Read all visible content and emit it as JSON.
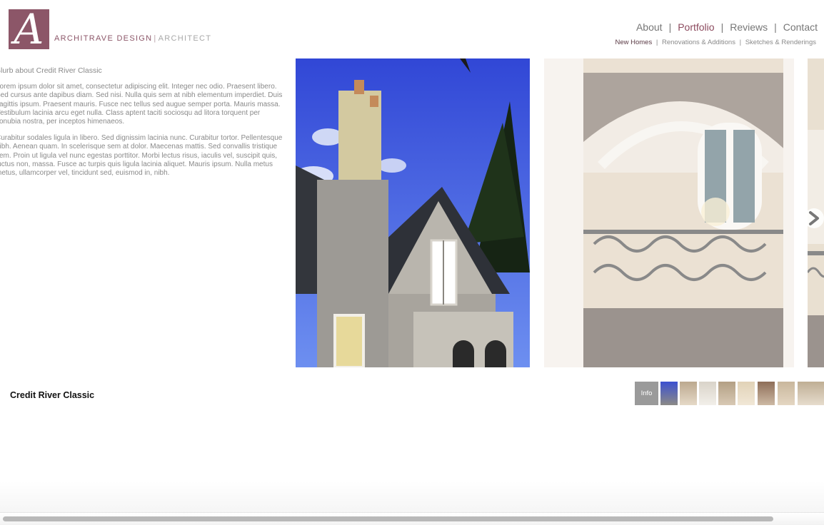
{
  "brand": {
    "logo_letter": "A",
    "name": "ARCHITRAVE DESIGN",
    "separator": "|",
    "role": "ARCHITECT",
    "accent": "#8c5668"
  },
  "nav": {
    "items": [
      "About",
      "Portfolio",
      "Reviews",
      "Contact"
    ],
    "active": "Portfolio",
    "separator": "|"
  },
  "subnav": {
    "items": [
      "New Homes",
      "Renovations & Additions",
      "Sketches & Renderings"
    ],
    "active": "New Homes",
    "separator": "|"
  },
  "blurb": {
    "title": "Blurb about Credit River Classic",
    "paragraphs": [
      "Lorem ipsum dolor sit amet, consectetur adipiscing elit. Integer nec odio. Praesent libero. Sed cursus ante dapibus diam. Sed nisi. Nulla quis sem at nibh elementum imperdiet. Duis sagittis ipsum. Praesent mauris. Fusce nec tellus sed augue semper porta. Mauris massa. Vestibulum lacinia arcu eget nulla. Class aptent taciti sociosqu ad litora torquent per conubia nostra, per inceptos himenaeos.",
      "Curabitur sodales ligula in libero. Sed dignissim lacinia nunc. Curabitur tortor. Pellentesque nibh. Aenean quam. In scelerisque sem at dolor. Maecenas mattis. Sed convallis tristique sem. Proin ut ligula vel nunc egestas porttitor. Morbi lectus risus, iaculis vel, suscipit quis, luctus non, massa. Fusce ac turpis quis ligula lacinia aliquet. Mauris ipsum. Nulla metus metus, ullamcorper vel, tincidunt sed, euismod in, nibh."
    ]
  },
  "gallery": {
    "caption": "Credit River Classic",
    "info_label": "Info",
    "next_icon": "chevron-right-icon"
  }
}
